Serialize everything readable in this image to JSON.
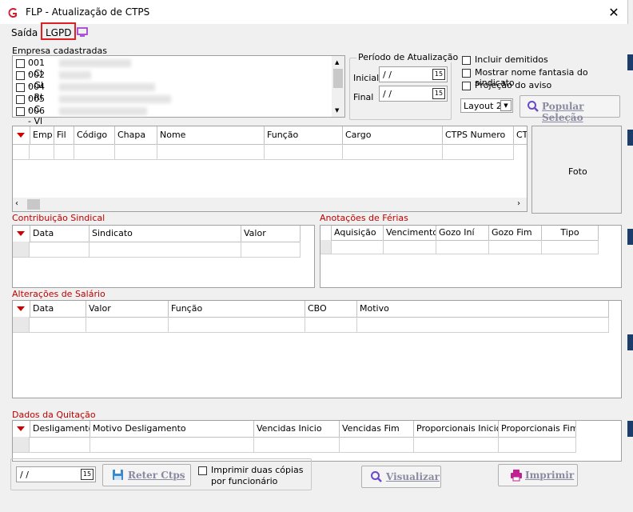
{
  "window": {
    "title": "FLP - Atualização de CTPS",
    "close_glyph": "✕"
  },
  "menu": {
    "exit_label": "Saída",
    "lgpd_label": "LGPD"
  },
  "companies": {
    "label": "Empresa cadastradas",
    "items": [
      "001 - Cl",
      "002 - Gl",
      "004 - Rl",
      "005 - C",
      "006 - Vl"
    ]
  },
  "period": {
    "legend": "Período de Atualização",
    "start_label": "Inicial",
    "start_value": " / /",
    "end_label": "Final",
    "end_value": " / /",
    "calendar_glyph": "15"
  },
  "options": {
    "include_dismissed": "Incluir demitidos",
    "show_fantasy_name": "Mostrar nome fantasia do sindicato",
    "notice_projection": "Projeção do aviso",
    "layout_value": "Layout 2",
    "populate_button": "Popular Seleção"
  },
  "employees_grid": {
    "columns": [
      "Emp",
      "Fil",
      "Código",
      "Chapa",
      "Nome",
      "Função",
      "Cargo",
      "CTPS Numero",
      "CT"
    ]
  },
  "photo_label": "Foto",
  "union_contribution": {
    "title": "Contribuição Sindical",
    "columns": [
      "Data",
      "Sindicato",
      "Valor"
    ]
  },
  "vacation_notes": {
    "title": "Anotações de Férias",
    "columns": [
      "Aquisição",
      "Vencimento",
      "Gozo Iní",
      "Gozo Fim",
      "Tipo"
    ]
  },
  "salary_changes": {
    "title": "Alterações de Salário",
    "columns": [
      "Data",
      "Valor",
      "Função",
      "CBO",
      "Motivo"
    ]
  },
  "discharge": {
    "title": "Dados da Quitação",
    "columns": [
      "Desligamento",
      "Motivo Desligamento",
      "Vencidas Inicio",
      "Vencidas Fim",
      "Proporcionais Inicio",
      "Proporcionais Fim"
    ]
  },
  "footer": {
    "date_value": " / /",
    "retain_button": "Reter Ctps",
    "print_two_copies": "Imprimir duas cópias",
    "print_two_copies_2": "por funcionário",
    "preview_button": "Visualizar",
    "print_button": "Imprimir"
  },
  "colors": {
    "accent_red": "#c00000",
    "frame_red": "#e02020",
    "app_icon": "#d02030",
    "monitor_icon": "#9b30d0"
  }
}
